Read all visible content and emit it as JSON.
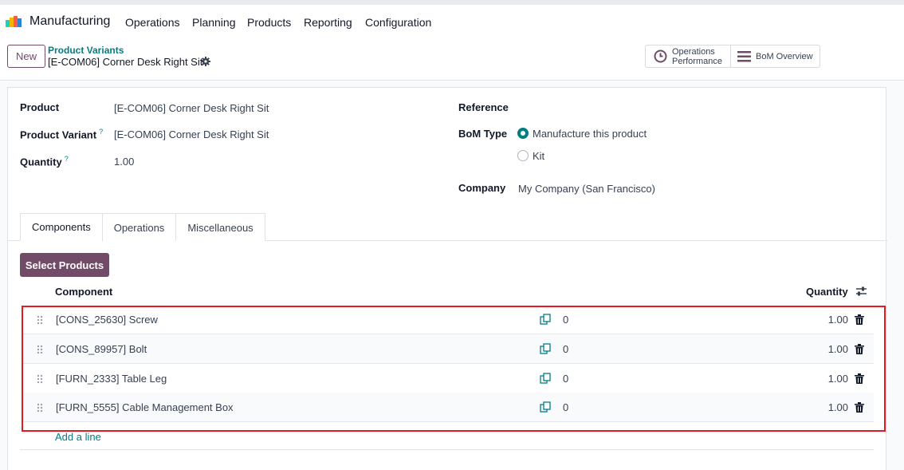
{
  "navbar": {
    "app_name": "Manufacturing",
    "menu": [
      "Operations",
      "Planning",
      "Products",
      "Reporting",
      "Configuration"
    ]
  },
  "control_panel": {
    "new_label": "New",
    "breadcrumb": "Product Variants",
    "record_title": "[E-COM06] Corner Desk Right Sit",
    "stat_ops_line1": "Operations",
    "stat_ops_line2": "Performance",
    "stat_bom": "BoM Overview"
  },
  "form": {
    "product_label": "Product",
    "product_value": "[E-COM06] Corner Desk Right Sit",
    "variant_label": "Product Variant",
    "variant_value": "[E-COM06] Corner Desk Right Sit",
    "quantity_label": "Quantity",
    "quantity_value": "1.00",
    "help_mark": "?",
    "reference_label": "Reference",
    "bom_type_label": "BoM Type",
    "bom_type_options": [
      "Manufacture this product",
      "Kit"
    ],
    "company_label": "Company",
    "company_value": "My Company (San Francisco)"
  },
  "tabs": [
    "Components",
    "Operations",
    "Miscellaneous"
  ],
  "components": {
    "select_products_label": "Select Products",
    "col_component": "Component",
    "col_quantity": "Quantity",
    "rows": [
      {
        "name": "[CONS_25630] Screw",
        "avail": "0",
        "qty": "1.00"
      },
      {
        "name": "[CONS_89957] Bolt",
        "avail": "0",
        "qty": "1.00"
      },
      {
        "name": "[FURN_2333] Table Leg",
        "avail": "0",
        "qty": "1.00"
      },
      {
        "name": "[FURN_5555] Cable Management Box",
        "avail": "0",
        "qty": "1.00"
      }
    ],
    "add_line_label": "Add a line"
  },
  "colors": {
    "primary": "#714B67",
    "accent": "#017e84",
    "highlight": "#e01b24"
  }
}
